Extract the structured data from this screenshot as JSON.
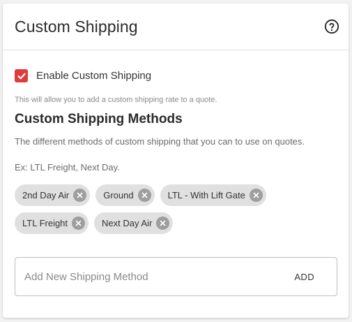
{
  "card": {
    "title": "Custom Shipping",
    "help_icon": "question-circle-icon"
  },
  "enable": {
    "checked": true,
    "label": "Enable Custom Shipping",
    "hint": "This will allow you to add a custom shipping rate to a quote."
  },
  "methods": {
    "title": "Custom Shipping Methods",
    "description": "The different methods of custom shipping that you can to use on quotes.",
    "example": "Ex: LTL Freight, Next Day.",
    "items": [
      {
        "label": "2nd Day Air"
      },
      {
        "label": "Ground"
      },
      {
        "label": "LTL - With Lift Gate"
      },
      {
        "label": "LTL Freight"
      },
      {
        "label": "Next Day Air"
      }
    ]
  },
  "add": {
    "value": "",
    "placeholder": "Add New Shipping Method",
    "button_label": "ADD"
  },
  "colors": {
    "checkbox": "#e03c3c",
    "chip_bg": "#e0e0e0",
    "chip_remove": "#9e9e9e"
  }
}
